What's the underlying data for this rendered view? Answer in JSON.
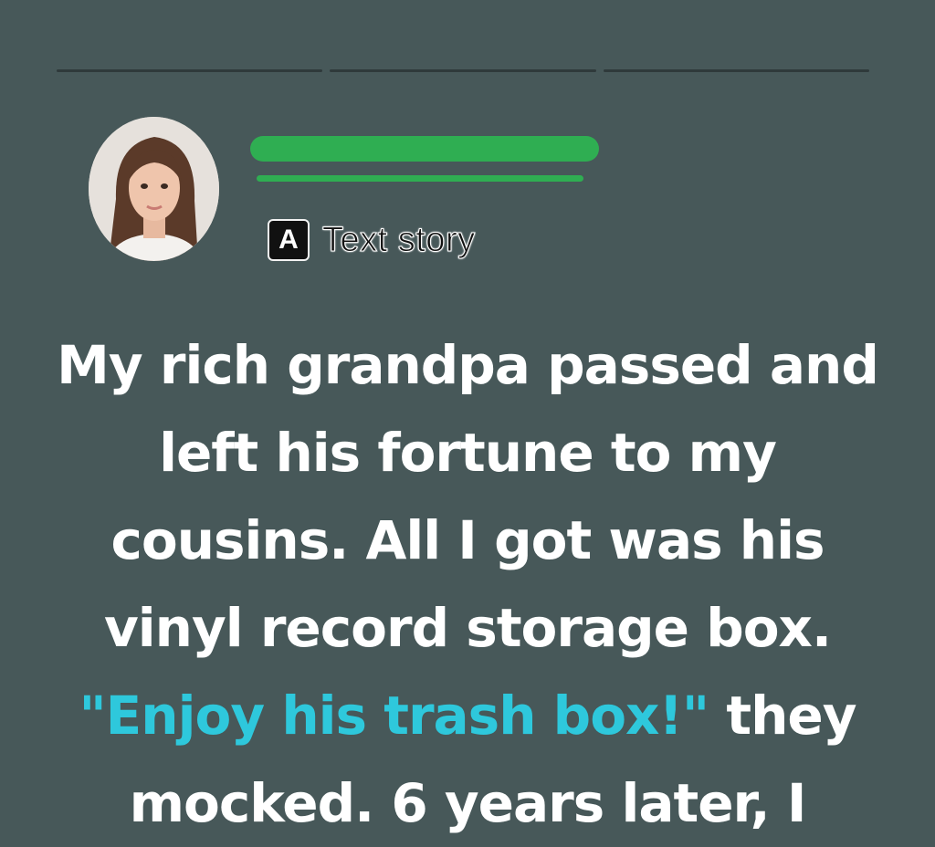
{
  "badge": {
    "icon_letter": "A",
    "label": "Text story"
  },
  "story": {
    "text_before": "My rich grandpa passed and left his fortune to my cousins. All I got was his vinyl record storage box.",
    "quote": "\"Enjoy his trash box!\"",
    "text_after": "they mocked. 6 years later, I"
  },
  "colors": {
    "background": "#475859",
    "quote": "#2ec8dc",
    "redaction": "#2fae52"
  },
  "icons": {
    "avatar": "profile-photo",
    "badge": "letter-a-icon"
  }
}
